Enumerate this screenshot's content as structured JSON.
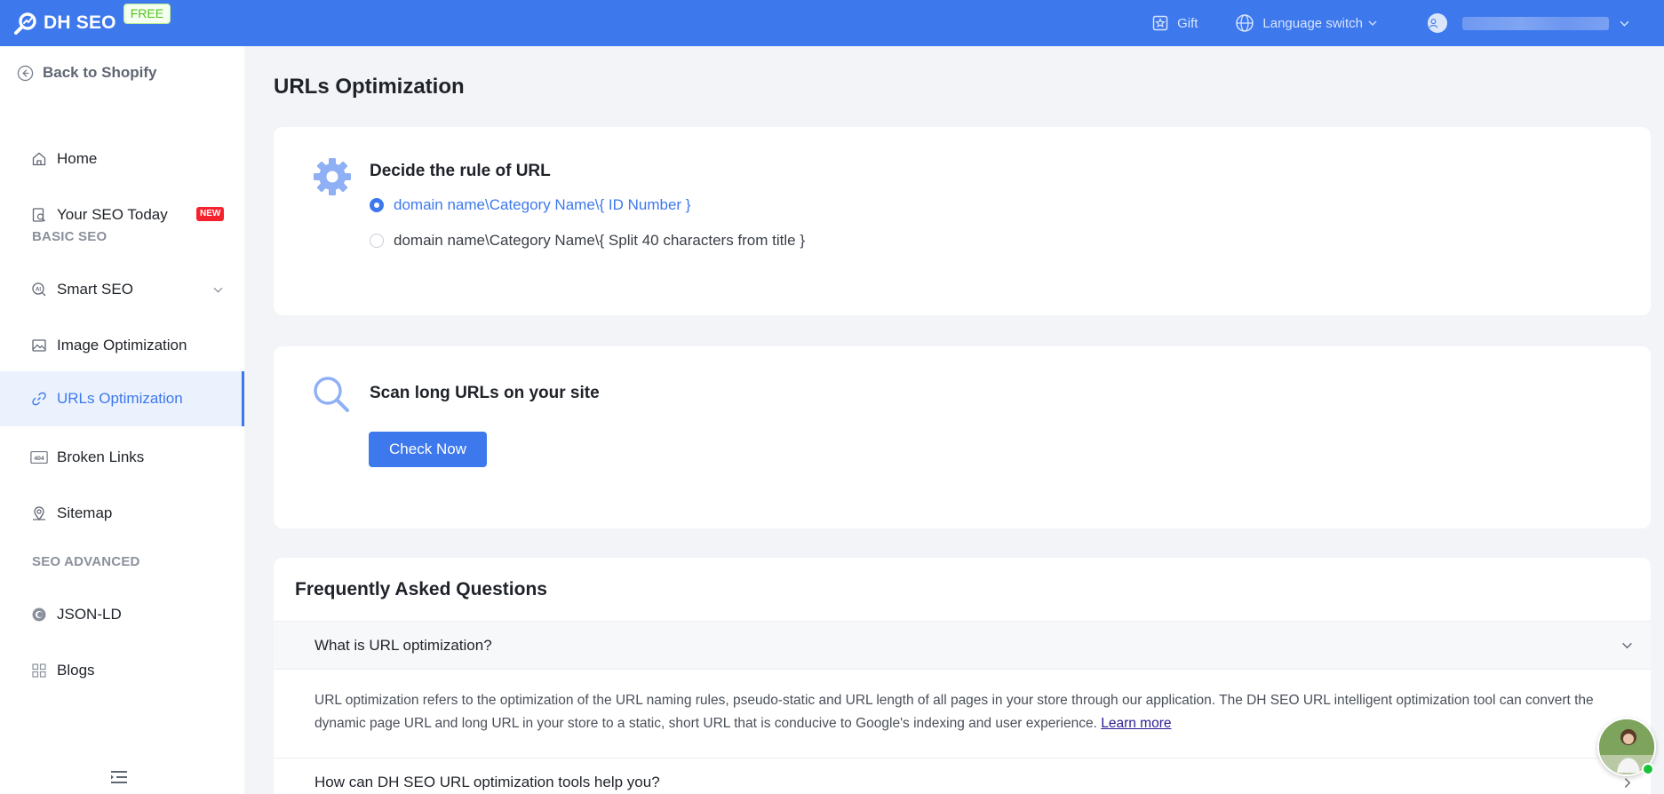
{
  "brand": {
    "name": "DH SEO",
    "badge": "FREE"
  },
  "topbar": {
    "gift": "Gift",
    "language": "Language switch"
  },
  "sidebar": {
    "back": "Back to Shopify",
    "items": [
      {
        "label": "Home"
      },
      {
        "label": "Your SEO Today",
        "badge": "NEW"
      },
      {
        "label": "Smart SEO"
      },
      {
        "label": "Image Optimization"
      },
      {
        "label": "URLs Optimization"
      },
      {
        "label": "Broken Links"
      },
      {
        "label": "Sitemap"
      },
      {
        "label": "JSON-LD"
      },
      {
        "label": "Blogs"
      }
    ],
    "sections": {
      "basic": "BASIC SEO",
      "advanced": "SEO ADVANCED"
    },
    "broken_links_icon_text": "404"
  },
  "main": {
    "title": "URLs Optimization",
    "rule_card": {
      "title": "Decide the rule of URL",
      "options": [
        {
          "label": "domain name\\Category Name\\{ ID Number }",
          "selected": true
        },
        {
          "label": "domain name\\Category Name\\{ Split 40 characters from title }",
          "selected": false
        }
      ]
    },
    "scan_card": {
      "title": "Scan long URLs on your site",
      "button": "Check Now"
    },
    "faq": {
      "title": "Frequently Asked Questions",
      "items": [
        {
          "question": "What is URL optimization?",
          "answer": "URL optimization refers to the optimization of the URL naming rules, pseudo-static and URL length of all pages in your store through our application. The DH SEO URL intelligent optimization tool can convert the dynamic page URL and long URL in your store to a static, short URL that is conducive to Google's indexing and user experience.",
          "link": "Learn more"
        },
        {
          "question": "How can DH SEO URL optimization tools help you?"
        }
      ]
    }
  },
  "colors": {
    "primary": "#3d78ed",
    "new_badge": "#f5222d",
    "free_badge_text": "#52c41a",
    "online": "#19c23a"
  },
  "icons": [
    "brand-logo-icon",
    "gift-icon",
    "globe-icon",
    "user-icon",
    "back-circle-icon",
    "home-icon",
    "report-icon",
    "ai-icon",
    "image-icon",
    "link-icon",
    "broken-link-404-icon",
    "location-pin-icon",
    "json-ld-icon",
    "blogs-grid-icon",
    "gear-icon",
    "magnifier-icon",
    "menu-collapse-icon",
    "chevron-down-icon"
  ]
}
